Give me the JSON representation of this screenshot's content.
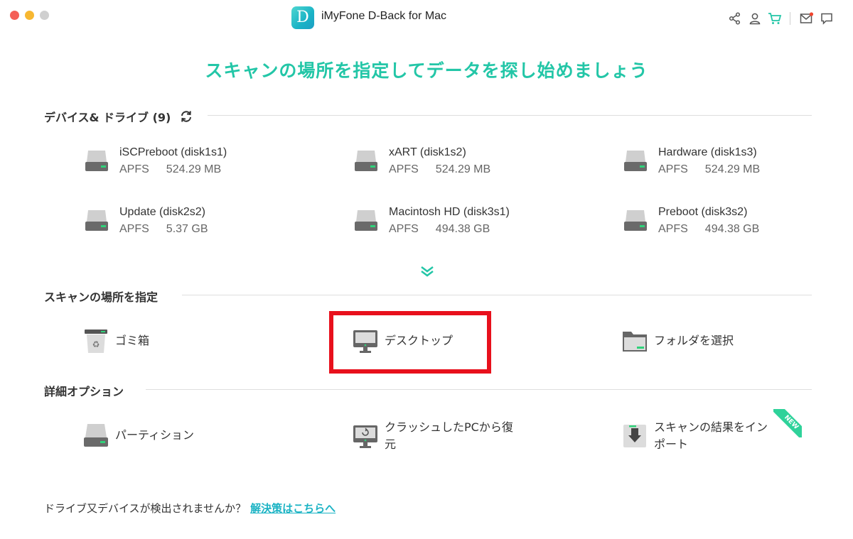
{
  "window": {
    "app_logo_letter": "D",
    "title": "iMyFone D-Back for Mac"
  },
  "toolbar_icons": [
    "share-icon",
    "user-icon",
    "cart-icon",
    "mail-icon",
    "chat-icon"
  ],
  "headline": "スキャンの場所を指定してデータを探し始めましょう",
  "devices": {
    "section_label": "デバイス& ドライブ (9)",
    "drives": [
      {
        "name": "iSCPreboot (disk1s1)",
        "fs": "APFS",
        "size": "524.29 MB"
      },
      {
        "name": "xART (disk1s2)",
        "fs": "APFS",
        "size": "524.29 MB"
      },
      {
        "name": "Hardware (disk1s3)",
        "fs": "APFS",
        "size": "524.29 MB"
      },
      {
        "name": "Update (disk2s2)",
        "fs": "APFS",
        "size": "5.37 GB"
      },
      {
        "name": "Macintosh HD (disk3s1)",
        "fs": "APFS",
        "size": "494.38 GB"
      },
      {
        "name": "Preboot (disk3s2)",
        "fs": "APFS",
        "size": "494.38 GB"
      }
    ]
  },
  "scan_location": {
    "section_label": "スキャンの場所を指定",
    "items": [
      {
        "label": "ゴミ箱"
      },
      {
        "label": "デスクトップ"
      },
      {
        "label": "フォルダを選択"
      }
    ]
  },
  "advanced": {
    "section_label": "詳細オプション",
    "items": [
      {
        "label": "パーティション"
      },
      {
        "label_line1": "クラッシュしたPCから復",
        "label_line2": "元"
      },
      {
        "label_line1": "スキャンの結果をイン",
        "label_line2": "ポート",
        "badge": "NEW"
      }
    ]
  },
  "footer": {
    "question": "ドライブ又デバイスが検出されませんか？",
    "link": "解決策はこちらへ"
  },
  "colors": {
    "accent": "#23c6a7",
    "link": "#1bb3c4",
    "highlight": "#e8101c",
    "drive_led": "#2fd27a"
  }
}
